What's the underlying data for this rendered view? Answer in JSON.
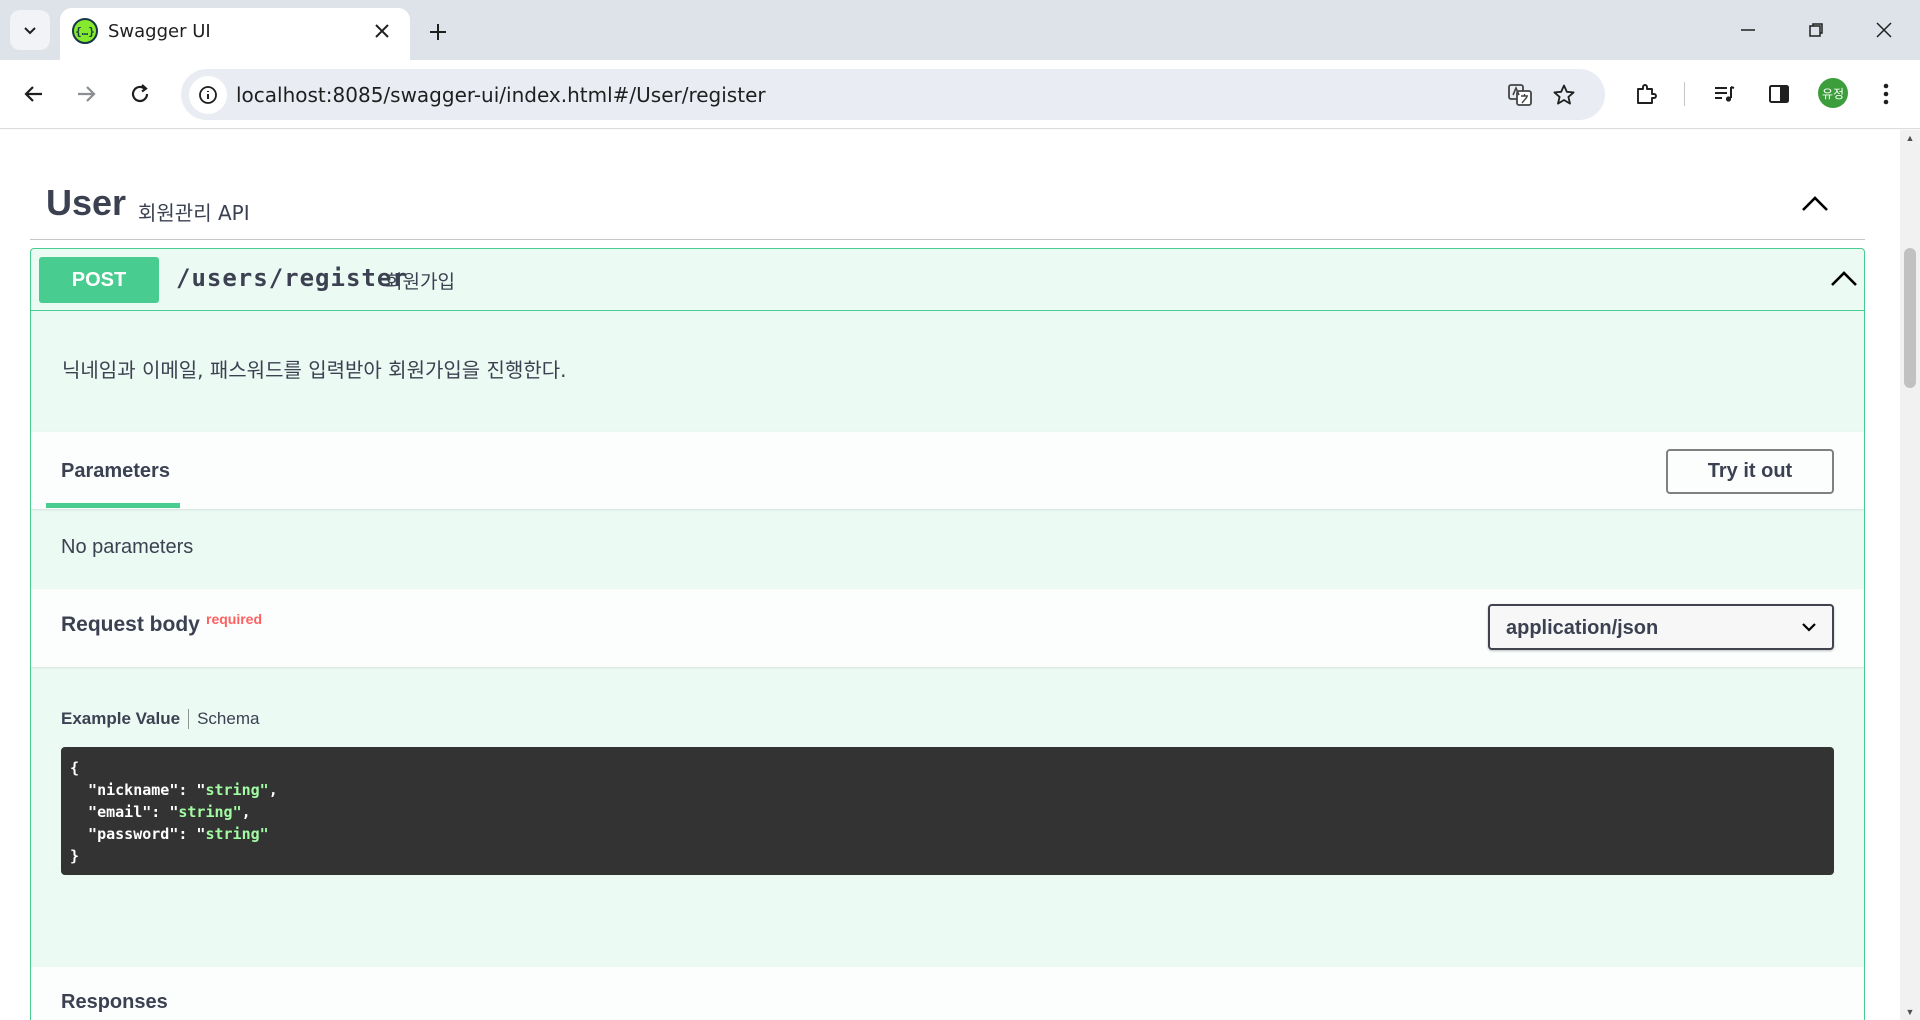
{
  "browser": {
    "tab_title": "Swagger UI",
    "favicon_text": "{…}",
    "url": "localhost:8085/swagger-ui/index.html#/User/register",
    "profile_initials": "유정"
  },
  "tag": {
    "name": "User",
    "description": "회원관리 API"
  },
  "operation": {
    "method": "POST",
    "path": "/users/register",
    "summary": "회원가입",
    "description": "닉네임과 이메일, 패스워드를 입력받아 회원가입을 진행한다.",
    "parameters_tab": "Parameters",
    "try_button": "Try it out",
    "no_parameters": "No parameters",
    "request_body_title": "Request body",
    "required_label": "required",
    "content_type": "application/json",
    "example_value_tab": "Example Value",
    "schema_tab": "Schema",
    "example_fields": [
      {
        "key": "nickname",
        "value": "string"
      },
      {
        "key": "email",
        "value": "string"
      },
      {
        "key": "password",
        "value": "string"
      }
    ],
    "responses_title": "Responses"
  },
  "colors": {
    "post": "#49cc90",
    "code_bg": "#333333",
    "code_string": "#a2fca2",
    "required": "#ff6060"
  }
}
